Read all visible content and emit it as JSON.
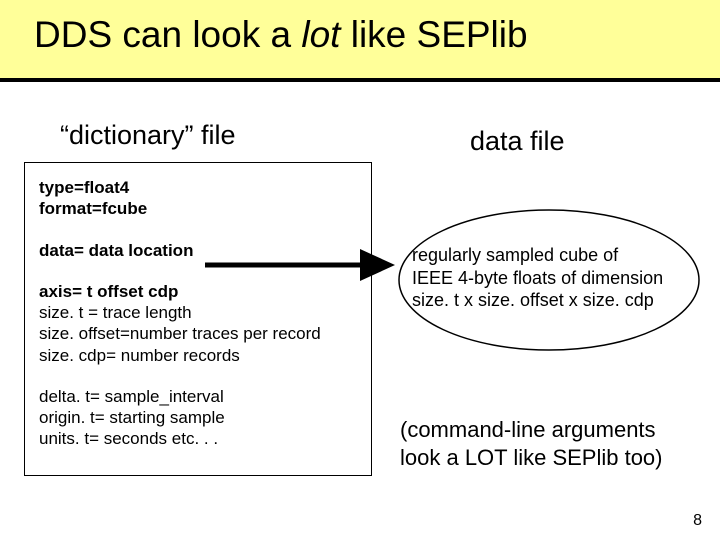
{
  "title": {
    "pre": "DDS can look a ",
    "ital": "lot",
    "post": " like SEPlib"
  },
  "subheads": {
    "left": "“dictionary” file",
    "right": "data file"
  },
  "dict": {
    "l1": "type=float4",
    "l2": "format=fcube",
    "l3": "data= data location",
    "l4": "axis= t offset cdp",
    "l5": "size. t = trace length",
    "l6": "size. offset=number traces per record",
    "l7": "size. cdp= number records",
    "l8": "delta. t= sample_interval",
    "l9": "origin. t= starting sample",
    "l10": "units. t= seconds   etc. . ."
  },
  "ellipse": {
    "l1": "regularly sampled cube of",
    "l2": "IEEE 4-byte floats of dimension",
    "l3": "size. t x size. offset x size. cdp"
  },
  "cmdline": {
    "l1": "(command-line arguments",
    "l2": "look a LOT like SEPlib too)"
  },
  "page_number": "8"
}
